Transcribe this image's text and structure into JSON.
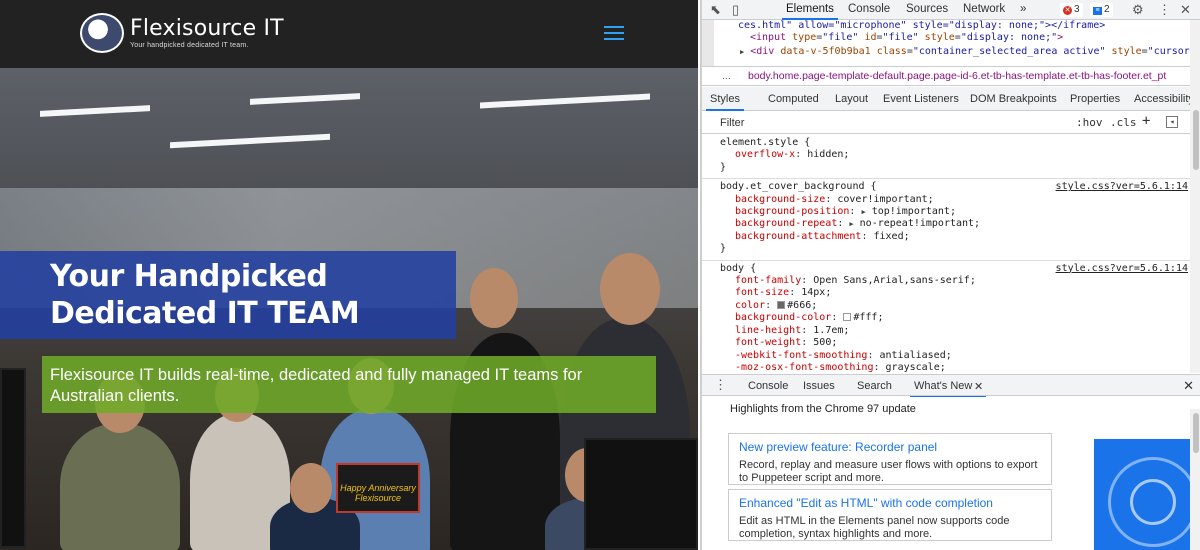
{
  "site": {
    "logo_name": "Flexisource IT",
    "logo_tagline": "Your handpicked dedicated IT team.",
    "headline_line1": "Your Handpicked",
    "headline_line2": "Dedicated IT TEAM",
    "subtext": "Flexisource IT builds real-time, dedicated and fully managed IT teams for Australian clients.",
    "cake_text": "Happy Anniversary Flexisource",
    "colors": {
      "header_bg": "#222222",
      "headline_box": "#2240a0",
      "sub_box": "#6eaa28",
      "menu_icon": "#2ea3f2"
    }
  },
  "devtools": {
    "tabs": [
      "Elements",
      "Console",
      "Sources",
      "Network"
    ],
    "more_tabs": "»",
    "error_count": "3",
    "message_count": "2",
    "dom_lines": {
      "line1": "ces.html\" allow=\"microphone\" style=\"display: none;\"></iframe>",
      "line2_tag_open": "<input ",
      "line2_attr1": "type",
      "line2_val1": "\"file\"",
      "line2_attr2": "id",
      "line2_val2": "\"file\"",
      "line2_attr3": "style",
      "line2_val3": "\"display: none;\"",
      "line2_close": ">",
      "line3_tag": "<div ",
      "line3_attr1": "data-v-5f0b9ba1",
      "line3_attr2": "class",
      "line3_val2": "\"container_selected_area active\"",
      "line3_attr3": "style",
      "line3_val3": "\"cursor:"
    },
    "breadcrumb_dots": "...",
    "breadcrumb": "body.home.page-template-default.page.page-id-6.et-tb-has-template.et-tb-has-footer.et_pt",
    "sub_tabs": [
      "Styles",
      "Computed",
      "Layout",
      "Event Listeners",
      "DOM Breakpoints",
      "Properties",
      "Accessibility"
    ],
    "filter_placeholder": "Filter",
    "hov": ":hov",
    "cls": ".cls",
    "plus": "+",
    "rules": [
      {
        "selector": "element.style {",
        "source": "",
        "decls": [
          [
            "overflow-x",
            "hidden;"
          ]
        ]
      },
      {
        "selector": "body.et_cover_background {",
        "source": "style.css?ver=5.6.1:14",
        "decls": [
          [
            "background-size",
            "cover!important;"
          ],
          [
            "background-position",
            "top!important;"
          ],
          [
            "background-repeat",
            "no-repeat!important;"
          ],
          [
            "background-attachment",
            "fixed;"
          ]
        ]
      },
      {
        "selector": "body {",
        "source": "style.css?ver=5.6.1:14",
        "decls": [
          [
            "font-family",
            "Open Sans,Arial,sans-serif;"
          ],
          [
            "font-size",
            "14px;"
          ],
          [
            "color",
            "#666;"
          ],
          [
            "background-color",
            "#fff;"
          ],
          [
            "line-height",
            "1.7em;"
          ],
          [
            "font-weight",
            "500;"
          ],
          [
            "-webkit-font-smoothing",
            "antialiased;"
          ],
          [
            "-moz-osx-font-smoothing",
            "grayscale;"
          ]
        ]
      }
    ],
    "drawer_tabs": [
      "Console",
      "Issues",
      "Search",
      "What's New"
    ],
    "whats_new_header": "Highlights from the Chrome 97 update",
    "cards": [
      {
        "title": "New preview feature: Recorder panel",
        "desc": "Record, replay and measure user flows with options to export to Puppeteer script and more."
      },
      {
        "title": "Enhanced \"Edit as HTML\" with code completion",
        "desc": "Edit as HTML in the Elements panel now supports code completion, syntax highlights and more."
      }
    ],
    "colors": {
      "accent": "#1a73e8",
      "error": "#d93025",
      "selector_prop": "#c80000"
    }
  }
}
